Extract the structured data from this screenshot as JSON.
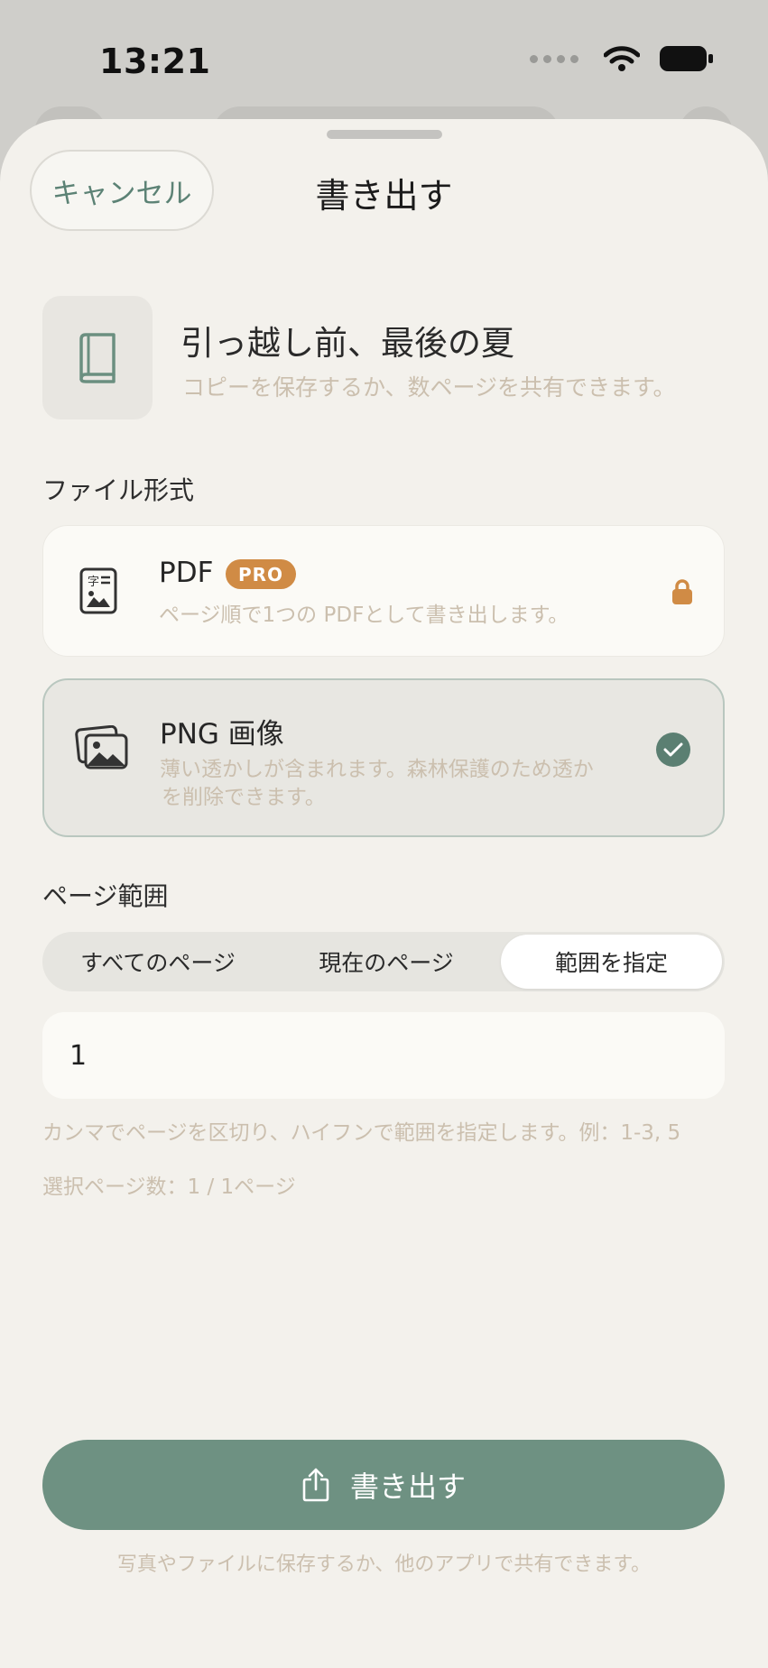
{
  "status": {
    "time": "13:21"
  },
  "header": {
    "cancel_label": "キャンセル",
    "title": "書き出す"
  },
  "document": {
    "title": "引っ越し前、最後の夏",
    "subtitle": "コピーを保存するか、数ページを共有できます。"
  },
  "format": {
    "section_label": "ファイル形式",
    "options": [
      {
        "name": "PDF",
        "badge": "PRO",
        "description": "ページ順で1つの PDFとして書き出します。",
        "locked": true,
        "selected": false
      },
      {
        "name": "PNG 画像",
        "description_line1": "薄い透かしが含まれます。森林保護のため透か",
        "description_line2": "を削除できます。",
        "selected": true
      }
    ]
  },
  "range": {
    "section_label": "ページ範囲",
    "segments": [
      "すべてのページ",
      "現在のページ",
      "範囲を指定"
    ],
    "selected_segment": "範囲を指定",
    "input_value": "1",
    "hint": "カンマでページを区切り、ハイフンで範囲を指定します。例：1-3, 5",
    "selected_count": "選択ページ数：1 / 1ページ"
  },
  "footer": {
    "export_label": "書き出す",
    "note": "写真やファイルに保存するか、他のアプリで共有できます。"
  },
  "colors": {
    "accent": "#6e9182",
    "badge": "#d08b45",
    "muted_text": "#cbbfae"
  },
  "icons": [
    "wifi-icon",
    "battery-icon",
    "book-icon",
    "pdf-document-icon",
    "pro-badge",
    "lock-icon",
    "images-icon",
    "checkmark-icon",
    "share-icon"
  ]
}
